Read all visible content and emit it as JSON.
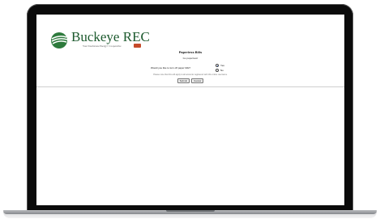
{
  "brand": {
    "name": "Buckeye REC",
    "tagline": "Your Touchstone Energy® Cooperative"
  },
  "form": {
    "title": "Paperless Bills",
    "subtitle": "Go paperless!",
    "question": "Would you like to turn off paper bills?",
    "options": [
      {
        "label": "Yes",
        "selected": true
      },
      {
        "label": "No",
        "selected": false
      }
    ],
    "note": "Please note that this will apply to all accounts registered with this online username.",
    "submit_label": "Submit",
    "cancel_label": "Cancel"
  },
  "colors": {
    "brand_green": "#1d5a2e",
    "radio_selected": "#1a56c9"
  },
  "icons": {
    "logo": "buckeye-rec-logo-icon",
    "state": "ohio-state-icon"
  }
}
